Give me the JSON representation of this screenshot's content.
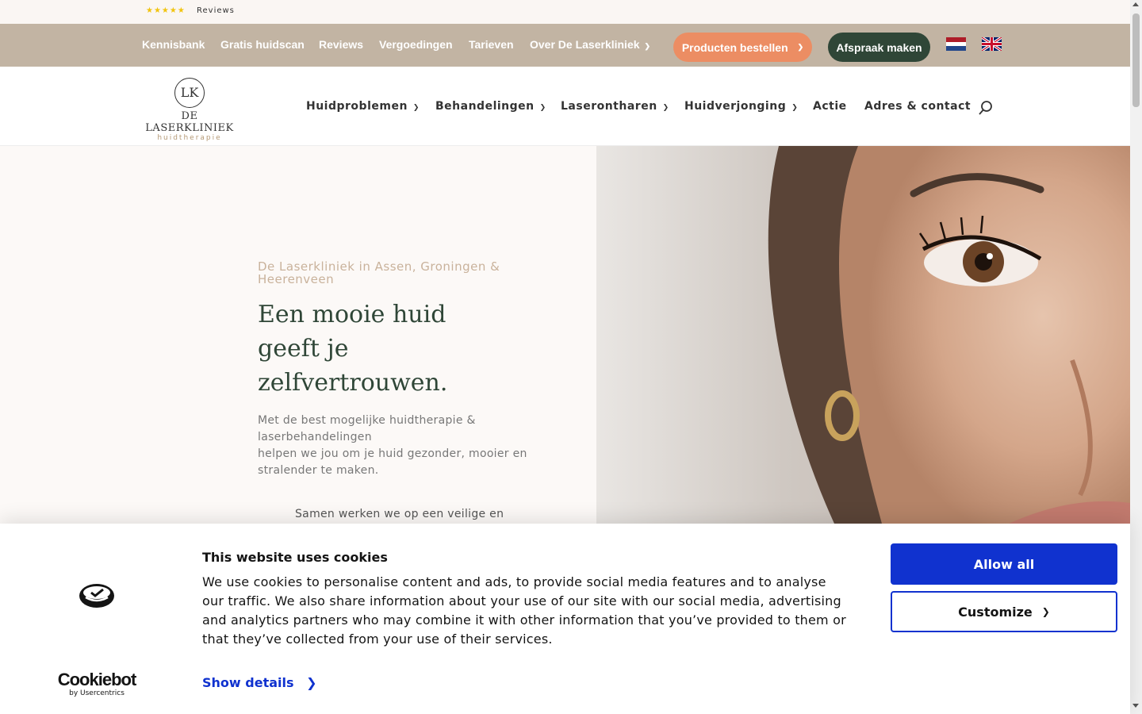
{
  "reviews_strip": {
    "stars": "★★★★★",
    "label": "Reviews"
  },
  "topnav": {
    "links": [
      "Kennisbank",
      "Gratis huidscan",
      "Reviews",
      "Vergoedingen",
      "Tarieven",
      "Over De Laserkliniek"
    ],
    "order_button": "Producten bestellen",
    "appointment_button": "Afspraak maken",
    "chevron_icon": "chevron-down-icon",
    "flags": [
      "flag-nl-icon",
      "flag-uk-icon"
    ]
  },
  "header": {
    "logo": {
      "monogram": "LK",
      "name": "DE LASERKLINIEK",
      "tagline": "huidtherapie"
    },
    "nav": [
      "Huidproblemen",
      "Behandelingen",
      "Laserontharen",
      "Huidverjonging",
      "Actie",
      "Adres & contact"
    ],
    "search_icon": "search-icon"
  },
  "hero": {
    "kicker": "De Laserkliniek in Assen, Groningen & Heerenveen",
    "headline_lines": [
      "Een mooie huid",
      "geeft je",
      "zelfvertrouwen."
    ],
    "lede_lines": [
      "Met de best mogelijke huidtherapie &",
      "laserbehandelingen",
      "helpen we jou om je huid gezonder, mooier en",
      "stralender te maken."
    ],
    "lede2": "Samen werken we op een veilige en",
    "image_icon": "woman-eye-photo"
  },
  "cookie": {
    "title": "This website uses cookies",
    "text": "We use cookies to personalise content and ads, to provide social media features and to analyse our traffic. We also share information about your use of our site with our social media, advertising and analytics partners who may combine it with other information that you’ve provided to them or that they’ve collected from your use of their services.",
    "show_details": "Show details",
    "allow_all": "Allow all",
    "customize": "Customize",
    "brand": "Cookiebot",
    "brand_by": "by Usercentrics",
    "colors": {
      "primary": "#1032cf",
      "text": "#141414"
    }
  },
  "colors": {
    "topnav_bg": "#c2b4a3",
    "order_btn": "#ec8d63",
    "appointment_btn": "#2f4637",
    "headline": "#2f4637",
    "kicker": "#c9b29b"
  }
}
